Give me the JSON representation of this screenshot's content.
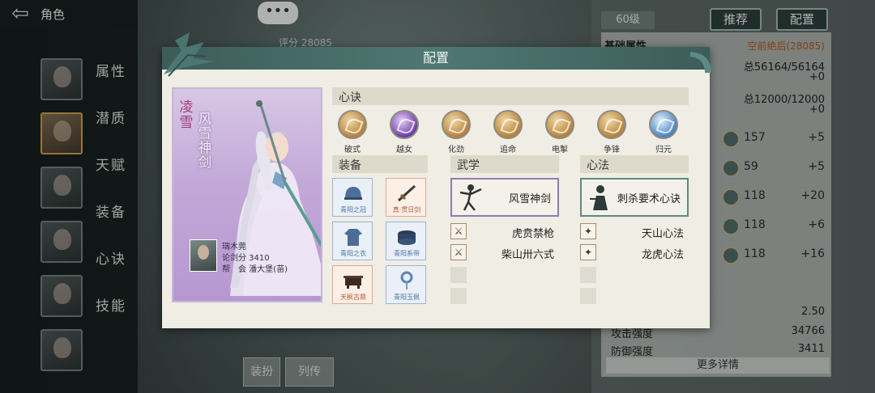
{
  "header": {
    "title": "角色",
    "back_icon": "back-arrow-icon"
  },
  "sidebar": {
    "menu": [
      "属性",
      "潜质",
      "天赋",
      "装备",
      "心诀",
      "技能"
    ]
  },
  "background": {
    "score": "评分 28085",
    "level": "60级",
    "recommend_btn": "推荐",
    "config_btn": "配置",
    "chat_label": "•••",
    "panel": {
      "header": "基础属性",
      "header_right": "空前绝后(28085)",
      "rows": [
        {
          "label": "",
          "value": "总56164/56164"
        },
        {
          "label": "",
          "value": "+0"
        },
        {
          "label": "",
          "value": "总12000/12000"
        },
        {
          "label": "",
          "value": "+0"
        }
      ],
      "skills": [
        {
          "name": "157",
          "plus": "+5"
        },
        {
          "name": "59",
          "plus": "+5"
        },
        {
          "name": "118",
          "plus": "+20"
        },
        {
          "name": "118",
          "plus": "+6"
        },
        {
          "name": "118",
          "plus": "+16"
        }
      ],
      "stats": [
        {
          "label": "",
          "value": "2.50"
        },
        {
          "label": "攻击强度",
          "value": "34766"
        },
        {
          "label": "防御强度",
          "value": "3411"
        }
      ],
      "more": "更多详情"
    },
    "bottom_left": "装扮",
    "bottom_right": "列传"
  },
  "modal": {
    "title": "配置",
    "portrait": {
      "name": "凌雪",
      "skill": "风雪神剑",
      "player": "瑞木莞",
      "score_label": "论剑分 3410",
      "guild_label": "帮　会 潘大堡(苗)"
    },
    "xinjue": {
      "title": "心诀",
      "items": [
        {
          "label": "破式",
          "icon": "break-stance-icon",
          "tone": "gold"
        },
        {
          "label": "越女",
          "icon": "yuenv-icon",
          "tone": "purple"
        },
        {
          "label": "化劲",
          "icon": "transform-force-icon",
          "tone": "gold"
        },
        {
          "label": "追命",
          "icon": "chase-life-icon",
          "tone": "gold"
        },
        {
          "label": "电掣",
          "icon": "lightning-icon",
          "tone": "gold"
        },
        {
          "label": "争锋",
          "icon": "contend-icon",
          "tone": "gold"
        },
        {
          "label": "归元",
          "icon": "return-origin-icon",
          "tone": "blue"
        }
      ]
    },
    "equipment": {
      "title": "装备",
      "items": [
        {
          "label": "青阳之冠",
          "icon": "helmet-icon",
          "rarity": "blue"
        },
        {
          "label": "真·贯日剑",
          "icon": "sword-icon",
          "rarity": "red"
        },
        {
          "label": "青阳之衣",
          "icon": "robe-icon",
          "rarity": "blue"
        },
        {
          "label": "青阳系带",
          "icon": "belt-icon",
          "rarity": "blue"
        },
        {
          "label": "天枫古鼎",
          "icon": "cauldron-icon",
          "rarity": "red"
        },
        {
          "label": "青阳玉佩",
          "icon": "jade-pendant-icon",
          "rarity": "blue"
        }
      ]
    },
    "wuxue": {
      "title": "武学",
      "main": "风雪神剑",
      "subs": [
        "虎贲禁枪",
        "柴山卅六式"
      ]
    },
    "xinfa": {
      "title": "心法",
      "main": "刺杀要术心诀",
      "subs": [
        "天山心法",
        "龙虎心法"
      ]
    }
  }
}
